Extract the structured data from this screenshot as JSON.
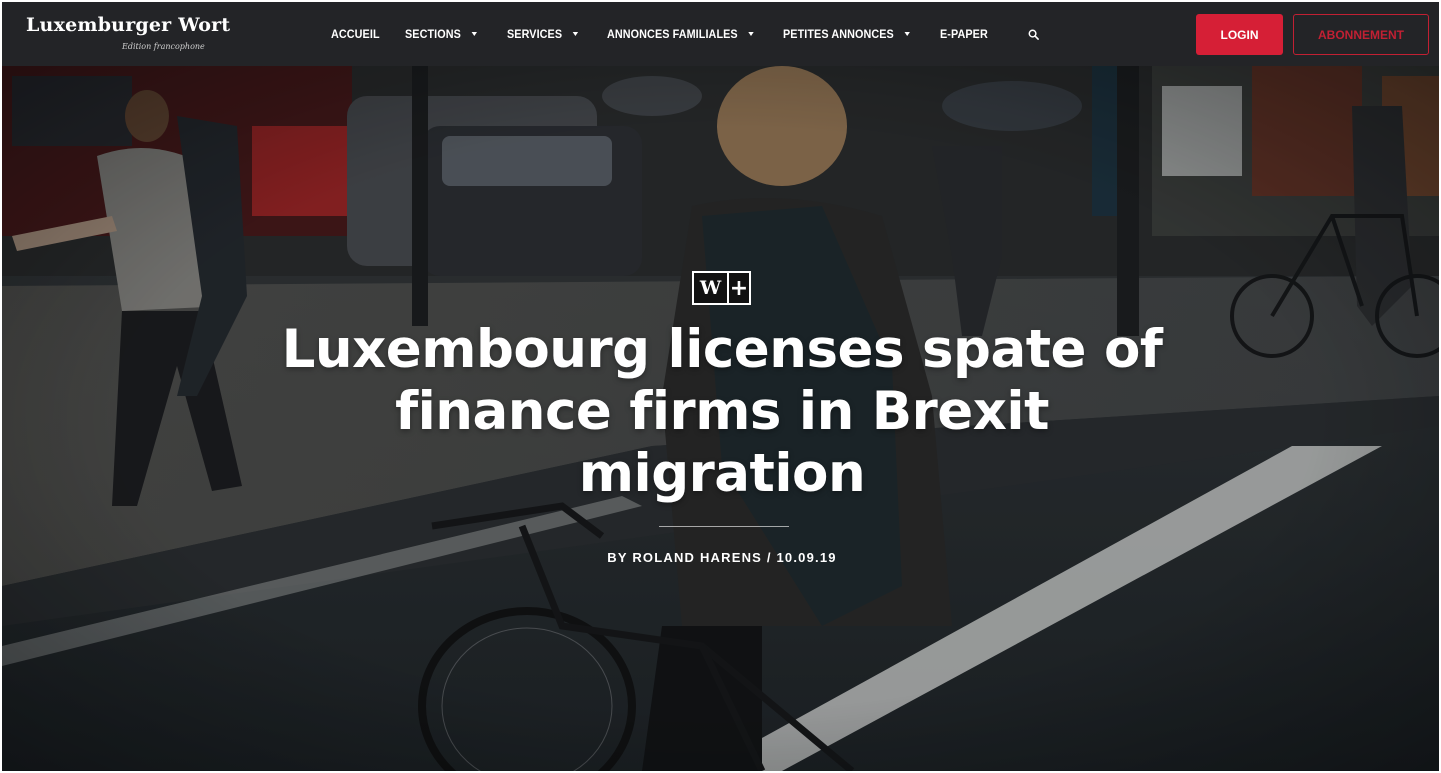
{
  "brand": {
    "name": "Luxemburger Wort",
    "edition": "Edition francophone"
  },
  "nav": {
    "items": [
      {
        "label": "ACCUEIL",
        "dropdown": false
      },
      {
        "label": "SECTIONS",
        "dropdown": true
      },
      {
        "label": "SERVICES",
        "dropdown": true
      },
      {
        "label": "ANNONCES FAMILIALES",
        "dropdown": true
      },
      {
        "label": "PETITES ANNONCES",
        "dropdown": true
      },
      {
        "label": "E-PAPER",
        "dropdown": false
      }
    ],
    "search_icon": "search-icon",
    "login_label": "LOGIN",
    "subscribe_label": "ABONNEMENT"
  },
  "article": {
    "badge_letter": "W",
    "badge_plus": "+",
    "headline": "Luxembourg licenses spate of finance firms in Brexit migration",
    "byline": "BY ROLAND HARENS / 10.09.19"
  },
  "colors": {
    "accent": "#d61f36",
    "navbar": "#232427"
  }
}
